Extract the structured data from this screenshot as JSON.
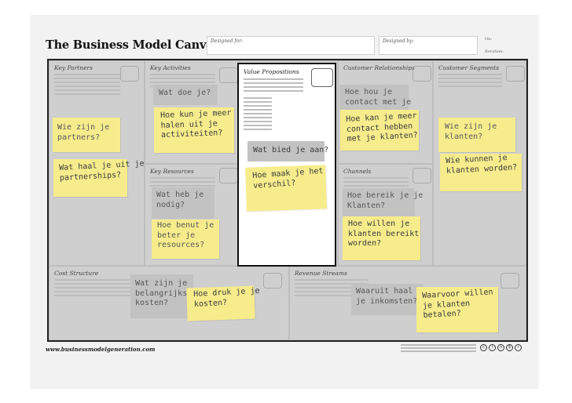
{
  "header": {
    "title": "The Business Model Canvas",
    "designed_for": "Designed for:",
    "designed_by": "Designed by:",
    "on": "On:",
    "iteration": "Iteration:"
  },
  "blocks": {
    "key_partners": "Key Partners",
    "key_activities": "Key Activities",
    "key_resources": "Key Resources",
    "value_propositions": "Value Propositions",
    "customer_relationships": "Customer Relationships",
    "channels": "Channels",
    "customer_segments": "Customer Segments",
    "cost_structure": "Cost Structure",
    "revenue_streams": "Revenue Streams"
  },
  "notes": {
    "kp_who": "Wie zijn je\npartners?",
    "kp_what": "Wat haal je uit je\npartnerships?",
    "ka_what": "Wat doe je?",
    "ka_more": "Hoe kun je meer\nhalen uit je\nactiviteiten?",
    "kr_need": "Wat heb je\nnodig?",
    "kr_use": "Hoe benut je\nbeter je\nresources?",
    "vp_offer": "Wat bied je aan?",
    "vp_diff": "Hoe maak je het\nverschil?",
    "cr_keep": "Hoe hou je\ncontact met je",
    "cr_more": "Hoe kan je meer\ncontact hebben\nmet je klanten?",
    "cs_who": "Wie zijn je\nklanten?",
    "cs_more": "Wie kunnen je\nklanten worden?",
    "ch_reach": "Hoe bereik je je\nKlanten?",
    "ch_want": "Hoe willen je\nklanten bereikt\nworden?",
    "cost_main": "Wat zijn je\nbelangrijkste\nkosten?",
    "cost_cut": "Hoe druk je je\nkosten?",
    "rev_from": "Waaruit haal je\nje inkomsten?",
    "rev_pay": "Waarvoor willen\nje klanten\nbetalen?"
  },
  "footer": {
    "url": "www.businessmodelgeneration.com"
  },
  "colors": {
    "sticky_yellow": "#f6ec8c",
    "sticky_gray": "#c2c2c2",
    "overlay_gray": "#cfcfcf"
  }
}
